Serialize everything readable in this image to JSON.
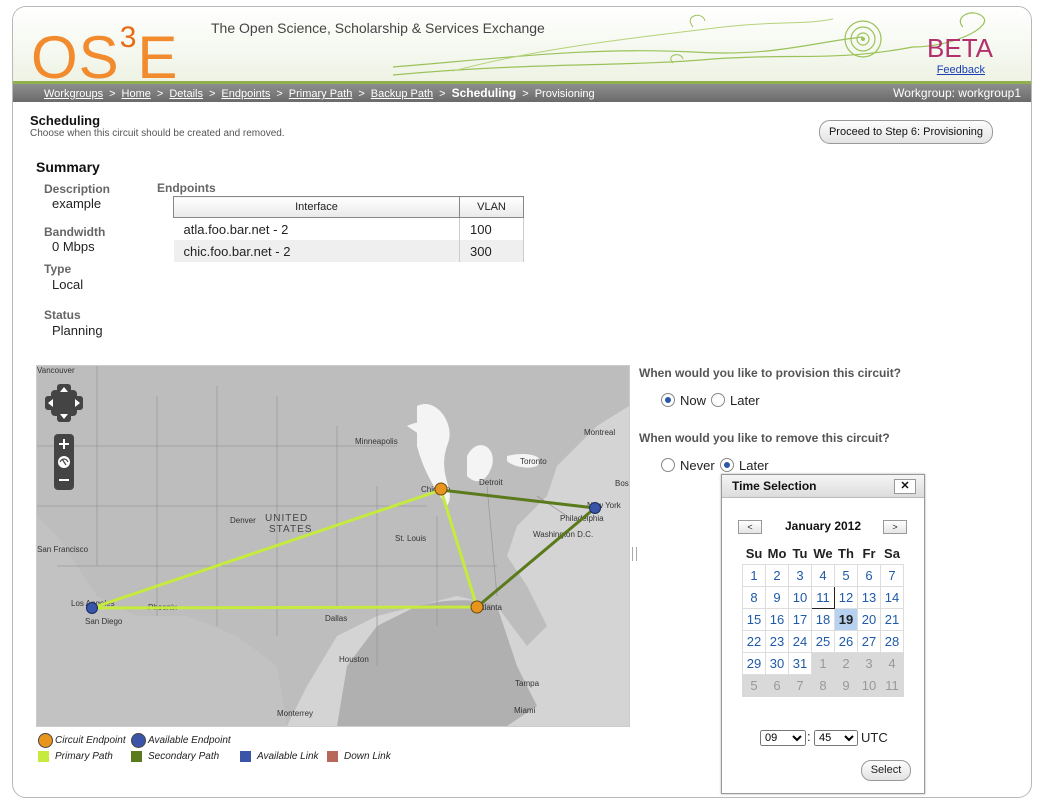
{
  "header": {
    "logo_letters": "OS",
    "logo_sup": "3",
    "logo_tail": "E",
    "tagline": "The Open Science, Scholarship & Services Exchange",
    "beta": "BETA",
    "feedback": "Feedback"
  },
  "breadcrumb": {
    "items": [
      "Workgroups",
      "Home",
      "Details",
      "Endpoints",
      "Primary Path",
      "Backup Path"
    ],
    "current": "Scheduling",
    "next": "Provisioning",
    "separator": ">",
    "workgroup": "Workgroup: workgroup1"
  },
  "page": {
    "title": "Scheduling",
    "subtitle": "Choose when this circuit should be created and removed.",
    "proceed_button": "Proceed to Step 6: Provisioning"
  },
  "summary": {
    "heading": "Summary",
    "description_label": "Description",
    "description_value": "example",
    "bandwidth_label": "Bandwidth",
    "bandwidth_value": "0 Mbps",
    "type_label": "Type",
    "type_value": "Local",
    "status_label": "Status",
    "status_value": "Planning"
  },
  "endpoints": {
    "heading": "Endpoints",
    "columns": [
      "Interface",
      "VLAN"
    ],
    "rows": [
      {
        "interface": "atla.foo.bar.net - 2",
        "vlan": "100"
      },
      {
        "interface": "chic.foo.bar.net - 2",
        "vlan": "300"
      }
    ]
  },
  "map": {
    "labels": {
      "country": "UNITED",
      "country2": "STATES",
      "cities": [
        "Minneapolis",
        "Chicago",
        "Detroit",
        "Toronto",
        "Montreal",
        "Boston",
        "New York",
        "Philadelphia",
        "Washington D.C.",
        "Denver",
        "St. Louis",
        "Los Angeles",
        "San Diego",
        "Phoenix",
        "Dallas",
        "Atlanta",
        "Houston",
        "Tampa",
        "Miami",
        "Monterrey",
        "San Francisco",
        "Vancouver"
      ]
    },
    "colors": {
      "primary_path": "#c6ea3d",
      "secondary_path": "#5a7a1c",
      "circuit_endpoint": "#e8951d",
      "available_endpoint": "#3a55a8"
    }
  },
  "legend": {
    "circuit_endpoint": "Circuit Endpoint",
    "available_endpoint": "Available Endpoint",
    "primary_path": "Primary Path",
    "secondary_path": "Secondary Path",
    "available_link": "Available Link",
    "down_link": "Down Link",
    "colors": {
      "circuit_endpoint": "#e8951d",
      "available_endpoint": "#3a55a8",
      "primary_path": "#c6ea3d",
      "secondary_path": "#5a7a1c",
      "available_link": "#3a55a8",
      "down_link": "#b8685a"
    }
  },
  "provision": {
    "question": "When would you like to provision this circuit?",
    "options": [
      "Now",
      "Later"
    ],
    "selected": "Now"
  },
  "remove": {
    "question": "When would you like to remove this circuit?",
    "options": [
      "Never",
      "Later"
    ],
    "selected": "Later"
  },
  "time_selection": {
    "title": "Time Selection",
    "close": "✕",
    "month": "January 2012",
    "prev": "<",
    "next": ">",
    "weekdays": [
      "Su",
      "Mo",
      "Tu",
      "We",
      "Th",
      "Fr",
      "Sa"
    ],
    "weeks": [
      [
        "1",
        "2",
        "3",
        "4",
        "5",
        "6",
        "7"
      ],
      [
        "8",
        "9",
        "10",
        "11",
        "12",
        "13",
        "14"
      ],
      [
        "15",
        "16",
        "17",
        "18",
        "19",
        "20",
        "21"
      ],
      [
        "22",
        "23",
        "24",
        "25",
        "26",
        "27",
        "28"
      ],
      [
        "29",
        "30",
        "31",
        "1",
        "2",
        "3",
        "4"
      ],
      [
        "5",
        "6",
        "7",
        "8",
        "9",
        "10",
        "11"
      ]
    ],
    "today": "11",
    "selected_day": "19",
    "hour": "09",
    "minute": "45",
    "timezone": "UTC",
    "select_button": "Select"
  }
}
